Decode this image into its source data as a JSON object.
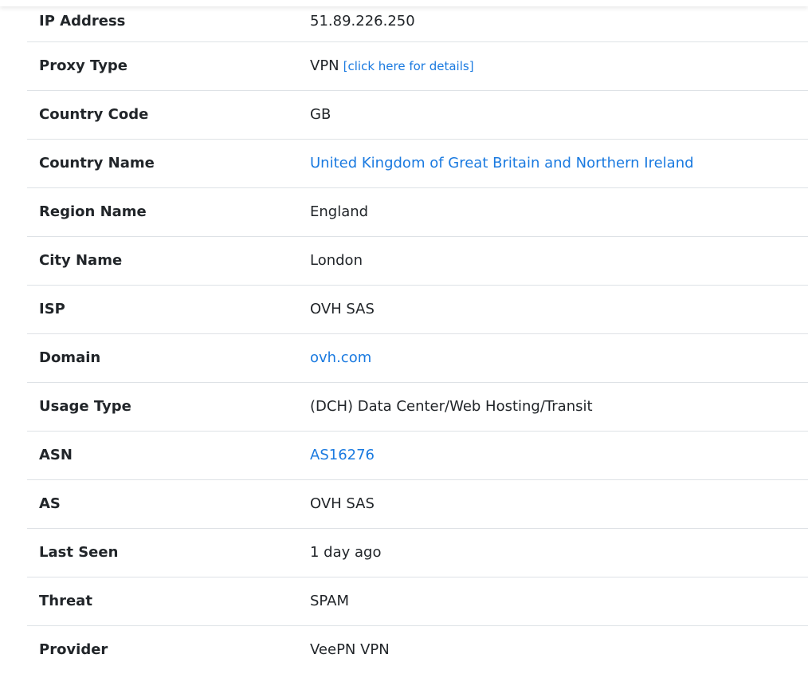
{
  "rows": [
    {
      "label": "IP Address",
      "value": "51.89.226.250",
      "link": false
    },
    {
      "label": "Proxy Type",
      "value": "VPN",
      "link": false,
      "extra_link": "[click here for details]"
    },
    {
      "label": "Country Code",
      "value": "GB",
      "link": false
    },
    {
      "label": "Country Name",
      "value": "United Kingdom of Great Britain and Northern Ireland",
      "link": true
    },
    {
      "label": "Region Name",
      "value": "England",
      "link": false
    },
    {
      "label": "City Name",
      "value": "London",
      "link": false
    },
    {
      "label": "ISP",
      "value": "OVH SAS",
      "link": false
    },
    {
      "label": "Domain",
      "value": "ovh.com",
      "link": true
    },
    {
      "label": "Usage Type",
      "value": "(DCH) Data Center/Web Hosting/Transit",
      "link": false
    },
    {
      "label": "ASN",
      "value": "AS16276",
      "link": true
    },
    {
      "label": "AS",
      "value": "OVH SAS",
      "link": false
    },
    {
      "label": "Last Seen",
      "value": "1 day ago",
      "link": false
    },
    {
      "label": "Threat",
      "value": "SPAM",
      "link": false
    },
    {
      "label": "Provider",
      "value": "VeePN VPN",
      "link": false
    }
  ],
  "colors": {
    "link": "#1a7ae0",
    "text": "#212529",
    "border": "#dee2e6"
  }
}
